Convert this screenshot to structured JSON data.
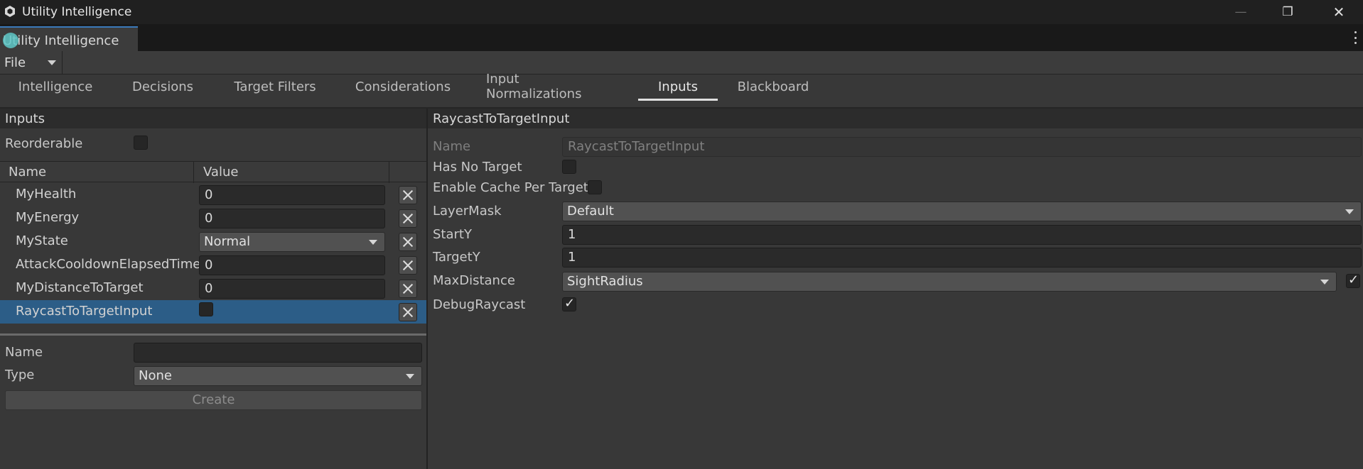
{
  "window": {
    "title": "Utility Intelligence",
    "minimize_glyph": "—",
    "restore_glyph": "❐",
    "close_glyph": "✕"
  },
  "doc_tab": {
    "label": "Utility Intelligence"
  },
  "toolbar": {
    "file_label": "File"
  },
  "nav_tabs": [
    {
      "label": "Intelligence"
    },
    {
      "label": "Decisions"
    },
    {
      "label": "Target Filters"
    },
    {
      "label": "Considerations"
    },
    {
      "label": "Input Normalizations"
    },
    {
      "label": "Inputs",
      "active": true
    },
    {
      "label": "Blackboard"
    }
  ],
  "inputs_panel": {
    "header": "Inputs",
    "reorderable_label": "Reorderable",
    "reorderable_checked": false,
    "columns": {
      "name": "Name",
      "value": "Value"
    },
    "rows": [
      {
        "name": "MyHealth",
        "value": "0",
        "kind": "text"
      },
      {
        "name": "MyEnergy",
        "value": "0",
        "kind": "text"
      },
      {
        "name": "MyState",
        "value": "Normal",
        "kind": "dropdown"
      },
      {
        "name": "AttackCooldownElapsedTime",
        "value": "0",
        "kind": "text"
      },
      {
        "name": "MyDistanceToTarget",
        "value": "0",
        "kind": "text"
      },
      {
        "name": "RaycastToTargetInput",
        "value": "",
        "kind": "checkbox",
        "selected": true
      }
    ],
    "new_input": {
      "name_label": "Name",
      "name_value": "",
      "type_label": "Type",
      "type_value": "None",
      "create_label": "Create"
    }
  },
  "detail_panel": {
    "header": "RaycastToTargetInput",
    "name_label": "Name",
    "name_value": "RaycastToTargetInput",
    "has_no_target_label": "Has No Target",
    "has_no_target_checked": false,
    "enable_cache_label": "Enable Cache Per Target",
    "enable_cache_checked": false,
    "layer_mask_label": "LayerMask",
    "layer_mask_value": "Default",
    "start_y_label": "StartY",
    "start_y_value": "1",
    "target_y_label": "TargetY",
    "target_y_value": "1",
    "max_distance_label": "MaxDistance",
    "max_distance_value": "SightRadius",
    "max_distance_toggle_checked": true,
    "debug_raycast_label": "DebugRaycast",
    "debug_raycast_checked": true
  },
  "colors": {
    "background": "#383838",
    "title_bar": "#202020",
    "selection": "#2c5d87",
    "header_bar": "#2c2c2c",
    "accent_cursor": "#5ec8c8"
  }
}
